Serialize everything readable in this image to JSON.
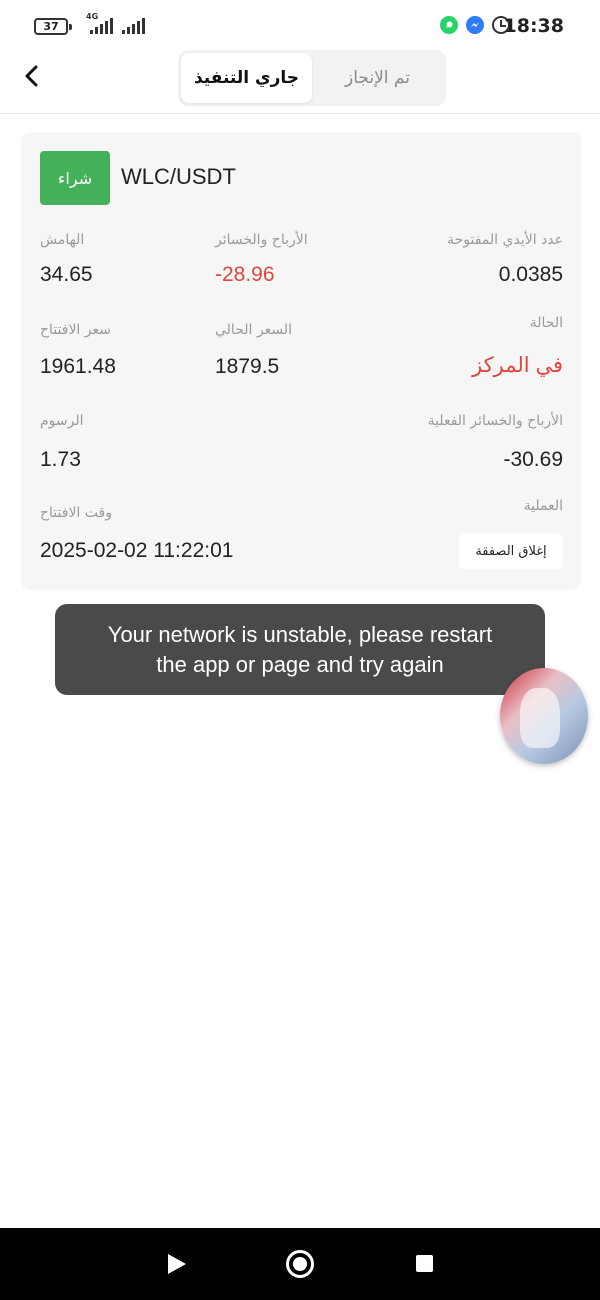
{
  "status_bar": {
    "battery": "37",
    "network": "4G",
    "time": "18:38",
    "icons": [
      "whatsapp-icon",
      "messenger-icon",
      "alarm-icon"
    ]
  },
  "header": {
    "back_icon": "chevron-left-icon",
    "tabs": [
      {
        "label": "جاري التنفيذ",
        "active": true
      },
      {
        "label": "تم الإنجاز",
        "active": false
      }
    ]
  },
  "position": {
    "side": "شراء",
    "side_color": "#44b05a",
    "pair": "WLC/USDT",
    "fields": {
      "margin": {
        "label": "الهامش",
        "value": "34.65"
      },
      "pnl": {
        "label": "الأرباح والخسائر",
        "value": "-28.96"
      },
      "open_lots": {
        "label": "عدد الأيدي المفتوحة",
        "value": "0.0385"
      },
      "open_price": {
        "label": "سعر الافتتاح",
        "value": "1961.48"
      },
      "current_price": {
        "label": "السعر الحالي",
        "value": "1879.5"
      },
      "status": {
        "label": "الحالة",
        "value": "في المركز"
      },
      "fees": {
        "label": "الرسوم",
        "value": "1.73"
      },
      "actual_pnl": {
        "label": "الأرباح والخسائر الفعلية",
        "value": "-30.69"
      },
      "open_time": {
        "label": "وقت الافتتاح",
        "value": "2025-02-02 11:22:01"
      },
      "operation": {
        "label": "العملية",
        "button": "إغلاق الصفقة"
      }
    },
    "negative_color": "#e0463a"
  },
  "toast": {
    "line1": "Your network is unstable, please restart",
    "line2": "the app or page and try again"
  },
  "nav_bar": {
    "icons": [
      "back-triangle-icon",
      "home-circle-icon",
      "recents-square-icon"
    ]
  }
}
